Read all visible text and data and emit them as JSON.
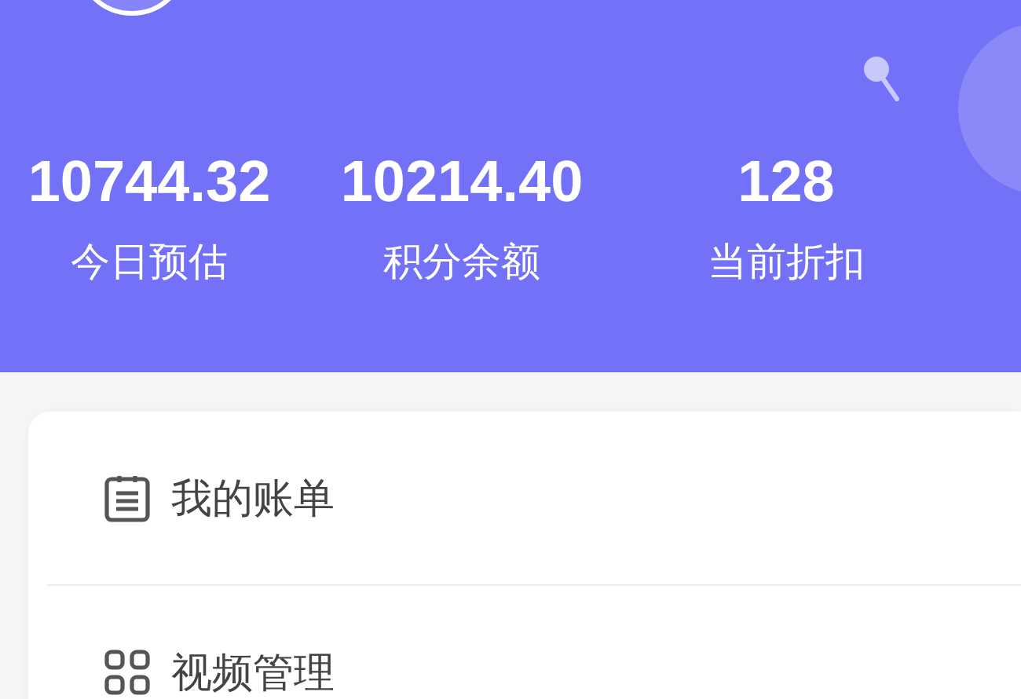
{
  "stats": [
    {
      "value": "10744.32",
      "label": "今日预估"
    },
    {
      "value": "10214.40",
      "label": "积分余额"
    },
    {
      "value": "128",
      "label": "当前折扣"
    }
  ],
  "menu": [
    {
      "kind": "clipboard",
      "label": "我的账单"
    },
    {
      "kind": "grid",
      "label": "视频管理"
    }
  ]
}
